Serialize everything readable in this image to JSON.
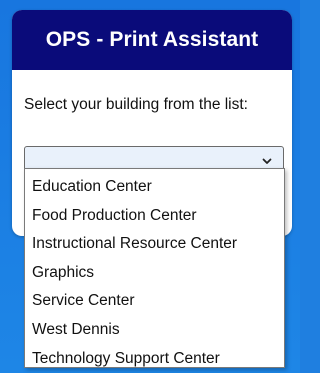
{
  "header": {
    "title": "OPS - Print Assistant"
  },
  "prompt": {
    "text": "Select your building from the list:"
  },
  "select": {
    "value": "",
    "options": [
      "Education Center",
      "Food Production Center",
      "Instructional Resource Center",
      "Graphics",
      "Service Center",
      "West Dennis",
      "Technology Support Center"
    ]
  },
  "icons": {
    "select_chevron": "chevron-down-icon"
  },
  "colors": {
    "header_bg": "#0a0b7a",
    "page_bg": "#1e86e6",
    "select_bg": "#e9f1fb"
  }
}
